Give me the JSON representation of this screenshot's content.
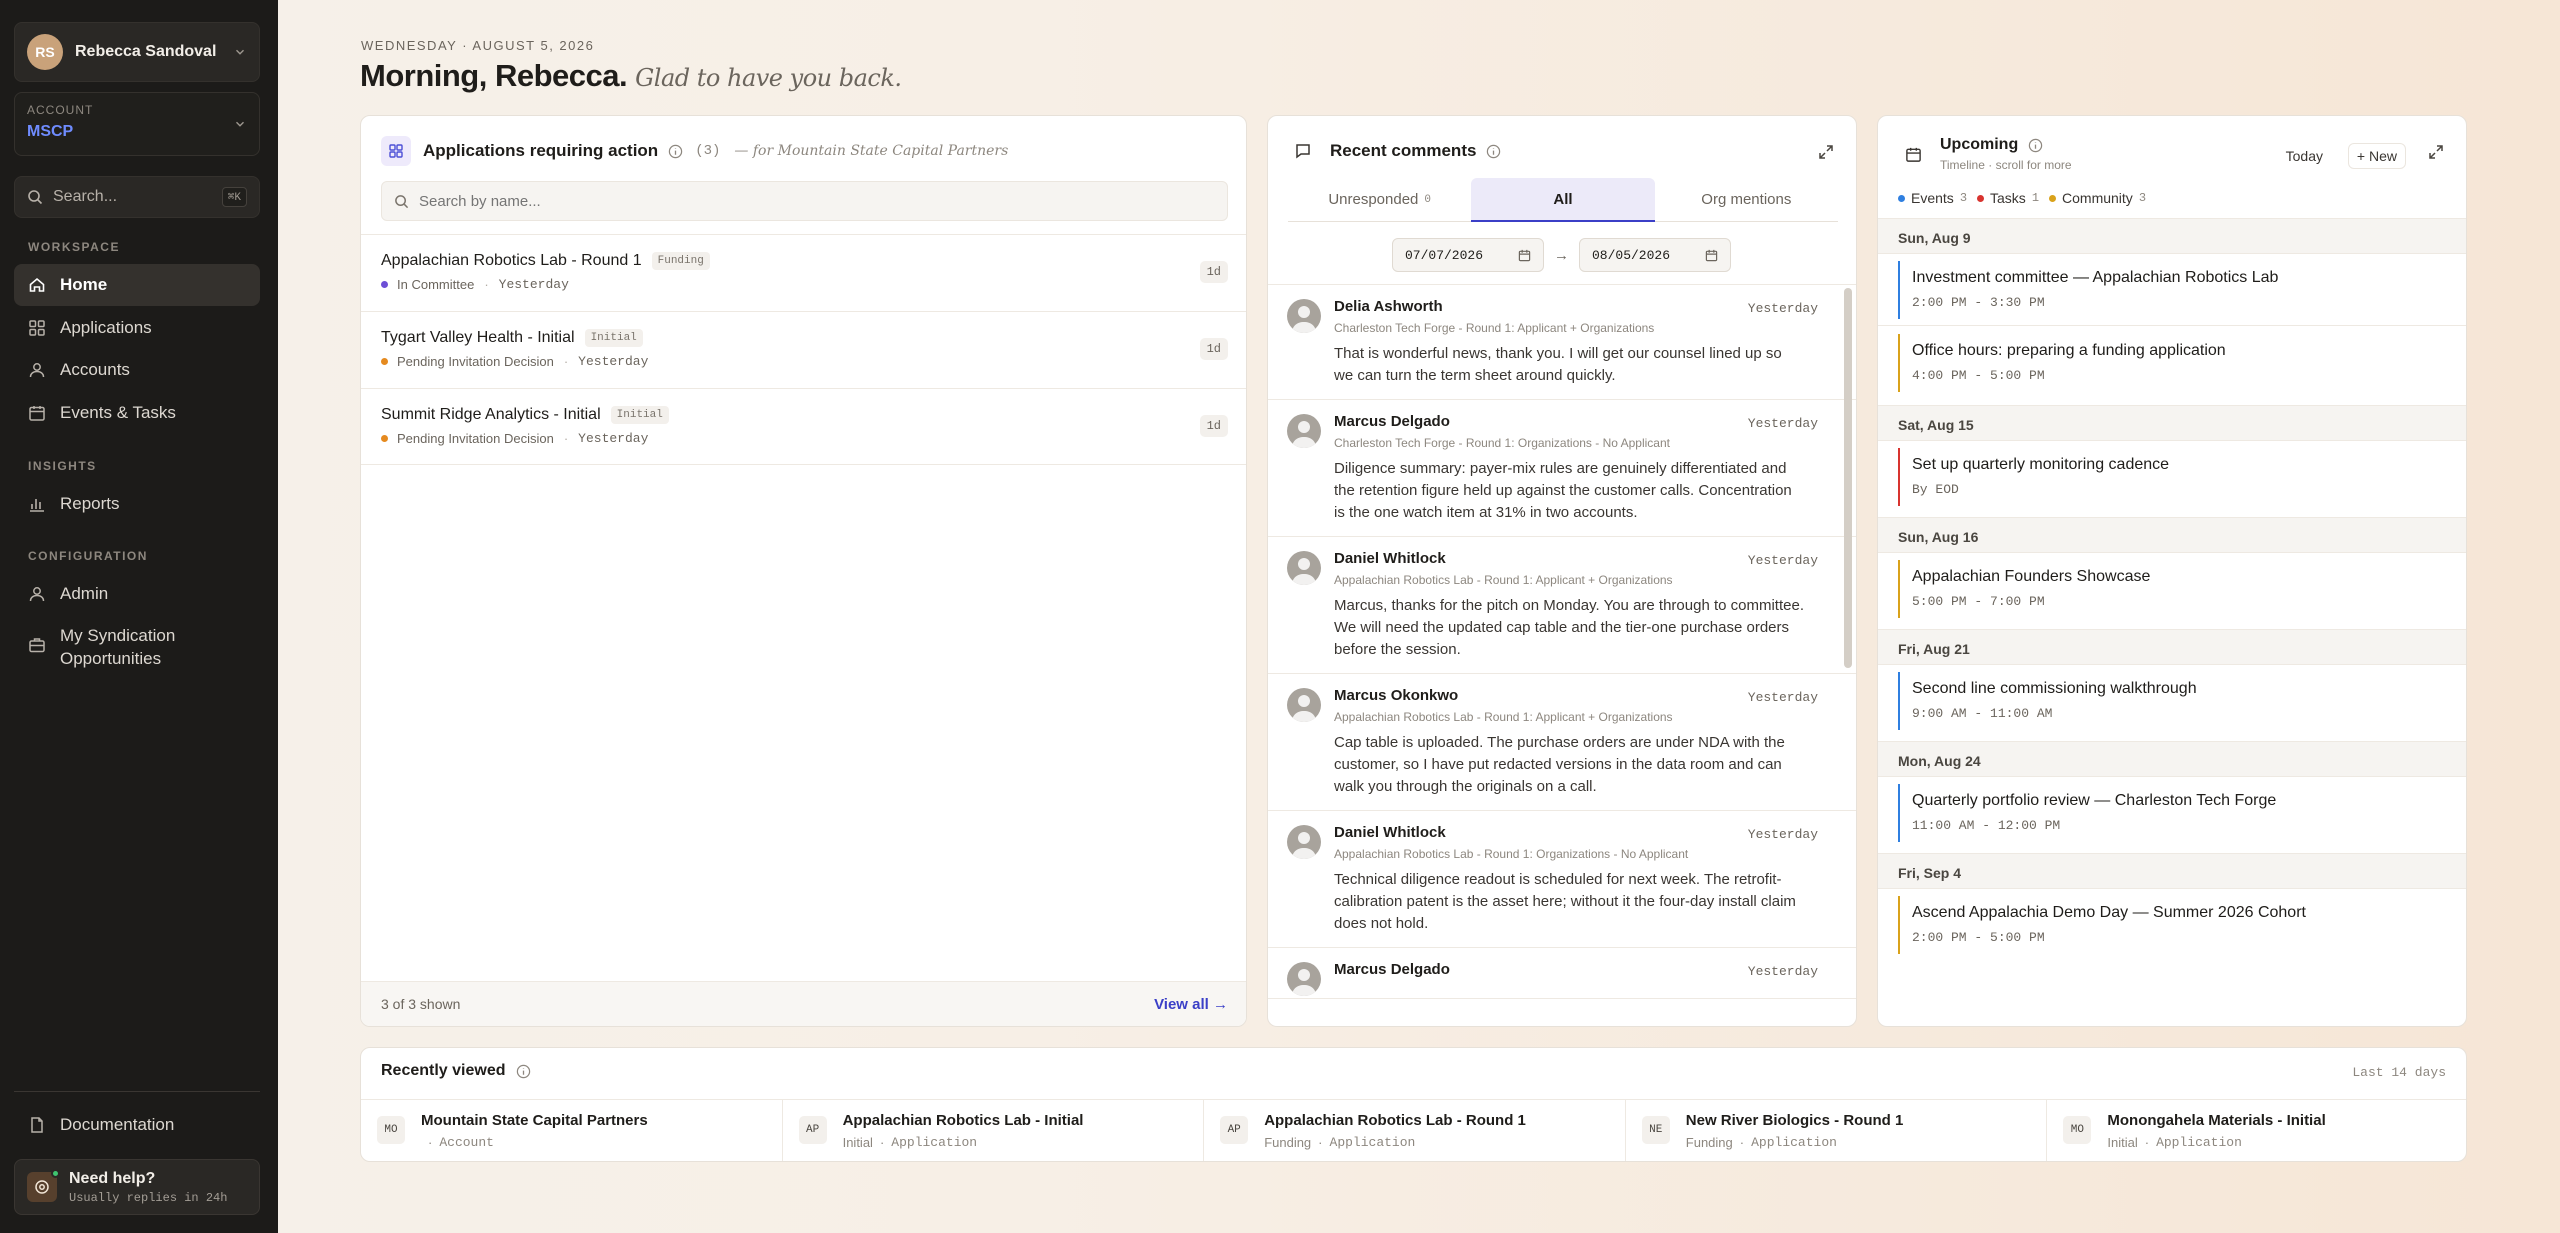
{
  "sidebar": {
    "user": {
      "initials": "RS",
      "name": "Rebecca Sandoval"
    },
    "account": {
      "label": "ACCOUNT",
      "value": "MSCP"
    },
    "search": {
      "label": "Search...",
      "shortcut": "⌘K"
    },
    "sections": {
      "workspace": "WORKSPACE",
      "insights": "INSIGHTS",
      "configuration": "CONFIGURATION"
    },
    "items": {
      "home": "Home",
      "applications": "Applications",
      "accounts": "Accounts",
      "events": "Events & Tasks",
      "reports": "Reports",
      "admin": "Admin",
      "syndication": "My Syndication Opportunities",
      "documentation": "Documentation"
    },
    "help": {
      "title": "Need help?",
      "subtitle": "Usually replies in 24h"
    }
  },
  "header": {
    "date": "WEDNESDAY · AUGUST 5, 2026",
    "greeting": "Morning, Rebecca.",
    "tagline": "Glad to have you back."
  },
  "applications": {
    "title": "Applications requiring action",
    "count": "(3)",
    "for_text": "— for Mountain State Capital Partners",
    "search_placeholder": "Search by name...",
    "rows": [
      {
        "name": "Appalachian Robotics Lab - Round 1",
        "tag": "Funding",
        "status": "In Committee",
        "status_color": "#6d4fd6",
        "when": "Yesterday",
        "age": "1d"
      },
      {
        "name": "Tygart Valley Health - Initial",
        "tag": "Initial",
        "status": "Pending Invitation Decision",
        "status_color": "#e58a1f",
        "when": "Yesterday",
        "age": "1d"
      },
      {
        "name": "Summit Ridge Analytics - Initial",
        "tag": "Initial",
        "status": "Pending Invitation Decision",
        "status_color": "#e58a1f",
        "when": "Yesterday",
        "age": "1d"
      }
    ],
    "footer_count": "3 of 3 shown",
    "view_all": "View all →"
  },
  "comments": {
    "title": "Recent comments",
    "tabs": {
      "unresponded": "Unresponded",
      "unresponded_count": "0",
      "all": "All",
      "org": "Org mentions"
    },
    "date_from": "07/07/2026",
    "date_to": "08/05/2026",
    "items": [
      {
        "name": "Delia Ashworth",
        "when": "Yesterday",
        "context": "Charleston Tech Forge - Round 1: Applicant + Organizations",
        "body": "That is wonderful news, thank you. I will get our counsel lined up so we can turn the term sheet around quickly."
      },
      {
        "name": "Marcus Delgado",
        "when": "Yesterday",
        "context": "Charleston Tech Forge - Round 1: Organizations - No Applicant",
        "body": "Diligence summary: payer-mix rules are genuinely differentiated and the retention figure held up against the customer calls. Concentration is the one watch item at 31% in two accounts."
      },
      {
        "name": "Daniel Whitlock",
        "when": "Yesterday",
        "context": "Appalachian Robotics Lab - Round 1: Applicant + Organizations",
        "body": "Marcus, thanks for the pitch on Monday. You are through to committee. We will need the updated cap table and the tier-one purchase orders before the session."
      },
      {
        "name": "Marcus Okonkwo",
        "when": "Yesterday",
        "context": "Appalachian Robotics Lab - Round 1: Applicant + Organizations",
        "body": "Cap table is uploaded. The purchase orders are under NDA with the customer, so I have put redacted versions in the data room and can walk you through the originals on a call."
      },
      {
        "name": "Daniel Whitlock",
        "when": "Yesterday",
        "context": "Appalachian Robotics Lab - Round 1: Organizations - No Applicant",
        "body": "Technical diligence readout is scheduled for next week. The retrofit-calibration patent is the asset here; without it the four-day install claim does not hold."
      },
      {
        "name": "Marcus Delgado",
        "when": "Yesterday",
        "context": "",
        "body": ""
      }
    ]
  },
  "upcoming": {
    "title": "Upcoming",
    "subtitle": "Timeline · scroll for more",
    "today": "Today",
    "new": "New",
    "legend": [
      {
        "label": "Events",
        "count": "3",
        "color": "#2f7fe0"
      },
      {
        "label": "Tasks",
        "count": "1",
        "color": "#d8342f"
      },
      {
        "label": "Community",
        "count": "3",
        "color": "#d9a21b"
      }
    ],
    "days": [
      {
        "date": "Sun, Aug 9",
        "events": [
          {
            "title": "Investment committee — Appalachian Robotics Lab",
            "time": "2:00 PM - 3:30 PM",
            "color": "#2f7fe0"
          },
          {
            "title": "Office hours: preparing a funding application",
            "time": "4:00 PM - 5:00 PM",
            "color": "#d9a21b"
          }
        ]
      },
      {
        "date": "Sat, Aug 15",
        "events": [
          {
            "title": "Set up quarterly monitoring cadence",
            "time": "By EOD",
            "color": "#d8342f"
          }
        ]
      },
      {
        "date": "Sun, Aug 16",
        "events": [
          {
            "title": "Appalachian Founders Showcase",
            "time": "5:00 PM - 7:00 PM",
            "color": "#d9a21b"
          }
        ]
      },
      {
        "date": "Fri, Aug 21",
        "events": [
          {
            "title": "Second line commissioning walkthrough",
            "time": "9:00 AM - 11:00 AM",
            "color": "#2f7fe0"
          }
        ]
      },
      {
        "date": "Mon, Aug 24",
        "events": [
          {
            "title": "Quarterly portfolio review — Charleston Tech Forge",
            "time": "11:00 AM - 12:00 PM",
            "color": "#2f7fe0"
          }
        ]
      },
      {
        "date": "Fri, Sep 4",
        "events": [
          {
            "title": "Ascend Appalachia Demo Day — Summer 2026 Cohort",
            "time": "2:00 PM - 5:00 PM",
            "color": "#d9a21b"
          }
        ]
      }
    ]
  },
  "recent": {
    "title": "Recently viewed",
    "range": "Last 14 days",
    "items": [
      {
        "badge": "MO",
        "name": "Mountain State Capital Partners",
        "sub": "",
        "type": "Account"
      },
      {
        "badge": "AP",
        "name": "Appalachian Robotics Lab - Initial",
        "sub": "Initial",
        "type": "Application"
      },
      {
        "badge": "AP",
        "name": "Appalachian Robotics Lab - Round 1",
        "sub": "Funding",
        "type": "Application"
      },
      {
        "badge": "NE",
        "name": "New River Biologics - Round 1",
        "sub": "Funding",
        "type": "Application"
      },
      {
        "badge": "MO",
        "name": "Monongahela Materials - Initial",
        "sub": "Initial",
        "type": "Application"
      }
    ]
  }
}
